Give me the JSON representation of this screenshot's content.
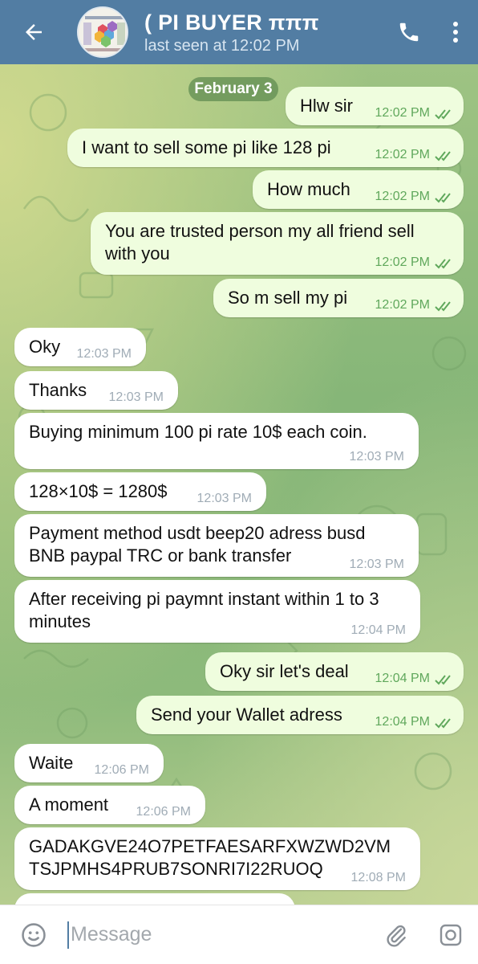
{
  "header": {
    "title": "( PI BUYER πππ",
    "status": "last seen at 12:02 PM",
    "icons": {
      "back": "arrow-left-icon",
      "call": "phone-icon",
      "menu": "more-vert-icon"
    },
    "color": "#527da3"
  },
  "date_label": "February 3",
  "messages": [
    {
      "dir": "out",
      "text": "Hlw sir",
      "time": "12:02 PM",
      "read": true
    },
    {
      "dir": "out",
      "text": "I want to sell some pi like 128 pi",
      "time": "12:02 PM",
      "read": true
    },
    {
      "dir": "out",
      "text": "How much",
      "time": "12:02 PM",
      "read": true
    },
    {
      "dir": "out",
      "text": "You are trusted person my all friend sell with you",
      "time": "12:02 PM",
      "read": true
    },
    {
      "dir": "out",
      "text": "So m sell my pi",
      "time": "12:02 PM",
      "read": true
    },
    {
      "dir": "in",
      "text": "Oky",
      "time": "12:03 PM"
    },
    {
      "dir": "in",
      "text": "Thanks",
      "time": "12:03 PM"
    },
    {
      "dir": "in",
      "text": "Buying minimum 100 pi rate 10$ each coin.",
      "time": "12:03 PM"
    },
    {
      "dir": "in",
      "text": "128×10$ = 1280$",
      "time": "12:03 PM"
    },
    {
      "dir": "in",
      "text": "Payment method usdt beep20 adress busd BNB paypal TRC or bank transfer",
      "time": "12:03 PM"
    },
    {
      "dir": "in",
      "text": "After receiving pi paymnt instant within 1 to 3 minutes",
      "time": "12:04 PM"
    },
    {
      "dir": "out",
      "text": "Oky sir let's deal",
      "time": "12:04 PM",
      "read": true
    },
    {
      "dir": "out",
      "text": "Send your Wallet adress",
      "time": "12:04 PM",
      "read": true
    },
    {
      "dir": "in",
      "text": "Waite",
      "time": "12:06 PM"
    },
    {
      "dir": "in",
      "text": "A moment",
      "time": "12:06 PM"
    },
    {
      "dir": "in",
      "text": "GADAKGVE24O7PETFAESARFXWZWD2VM TSJPMHS4PRUB7SONRI7I22RUOQ",
      "time": "12:08 PM"
    }
  ],
  "composer": {
    "placeholder": "Message",
    "icons": {
      "emoji": "emoji-icon",
      "attach": "paperclip-icon",
      "camera": "camera-icon"
    }
  },
  "colors": {
    "outgoing_bubble": "#effdde",
    "incoming_bubble": "#ffffff",
    "read_ticks": "#60a85c",
    "incoming_time": "#a0acb6"
  }
}
